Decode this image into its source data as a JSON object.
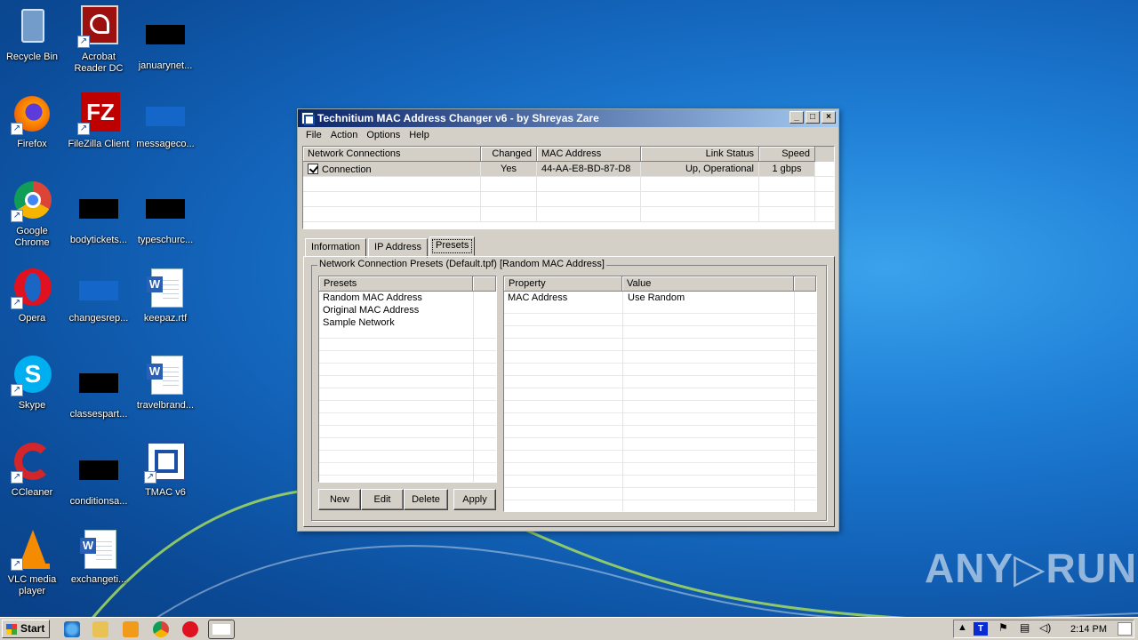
{
  "desktop": {
    "icons": [
      {
        "label": "Recycle Bin"
      },
      {
        "label": "Acrobat\nReader DC"
      },
      {
        "label": "januarynet..."
      },
      {
        "label": "Firefox"
      },
      {
        "label": "FileZilla Client"
      },
      {
        "label": "messageco..."
      },
      {
        "label": "Google\nChrome"
      },
      {
        "label": "bodytickets..."
      },
      {
        "label": "typeschurc..."
      },
      {
        "label": "Opera"
      },
      {
        "label": "changesrep..."
      },
      {
        "label": "keepaz.rtf"
      },
      {
        "label": "Skype"
      },
      {
        "label": "classespart..."
      },
      {
        "label": "travelbrand..."
      },
      {
        "label": "CCleaner"
      },
      {
        "label": "conditionsa..."
      },
      {
        "label": "TMAC v6"
      },
      {
        "label": "VLC media\nplayer"
      },
      {
        "label": "exchangeti..."
      }
    ]
  },
  "window": {
    "title": "Technitium MAC Address Changer v6 - by Shreyas Zare",
    "menu": [
      "File",
      "Action",
      "Options",
      "Help"
    ],
    "connections": {
      "columns": [
        "Network Connections",
        "Changed",
        "MAC Address",
        "Link Status",
        "Speed"
      ],
      "rows": [
        {
          "name": "Connection",
          "changed": "Yes",
          "mac": "44-AA-E8-BD-87-D8",
          "status": "Up, Operational",
          "speed": "1 gbps"
        }
      ]
    },
    "tabs": [
      "Information",
      "IP Address",
      "Presets"
    ],
    "group_title": "Network Connection Presets (Default.tpf) [Random MAC Address]",
    "presets": {
      "column": "Presets",
      "items": [
        "Random MAC Address",
        "Original MAC Address",
        "Sample Network"
      ]
    },
    "properties": {
      "columns": [
        "Property",
        "Value"
      ],
      "rows": [
        {
          "property": "MAC Address",
          "value": "Use Random"
        }
      ]
    },
    "buttons": {
      "new": "New",
      "edit": "Edit",
      "delete": "Delete",
      "apply": "Apply"
    }
  },
  "taskbar": {
    "start_label": "Start",
    "clock": "2:14 PM"
  },
  "watermark": "ANY▷RUN"
}
